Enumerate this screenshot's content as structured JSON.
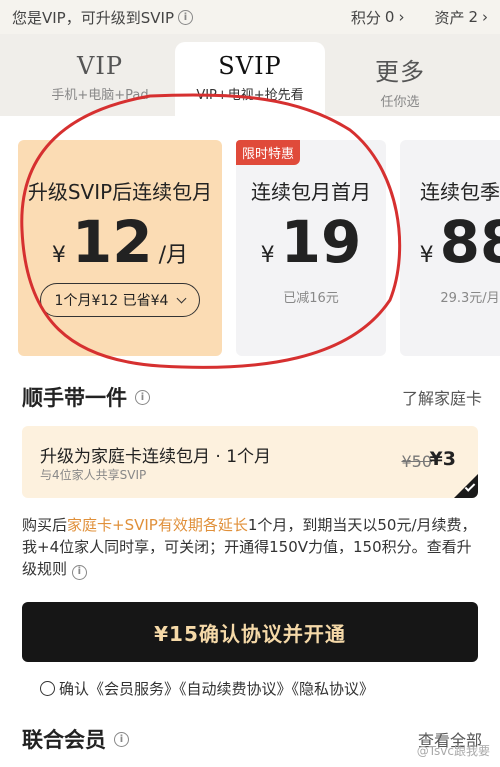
{
  "topbar": {
    "status": "您是VIP，可升级到SVIP",
    "points_label": "积分",
    "points_value": "0",
    "assets_label": "资产",
    "assets_value": "2"
  },
  "tabs": [
    {
      "name": "VIP",
      "sub": "手机+电脑+Pad"
    },
    {
      "name": "SVIP",
      "sub": "VIP+电视+抢先看"
    },
    {
      "name": "更多",
      "sub": "任你选"
    }
  ],
  "plans": [
    {
      "title": "升级SVIP后连续包月",
      "currency": "¥",
      "amount": "12",
      "unit": "/月",
      "selector": "1个月¥12 已省¥4"
    },
    {
      "badge": "限时特惠",
      "title": "连续包月首月",
      "currency": "¥",
      "amount": "19",
      "note": "已减16元"
    },
    {
      "title": "连续包季首",
      "currency": "¥",
      "amount": "88",
      "note": "29.3元/月"
    }
  ],
  "addon": {
    "heading": "顺手带一件",
    "link": "了解家庭卡",
    "card_title": "升级为家庭卡连续包月 · 1个月",
    "card_sub": "与4位家人共享SVIP",
    "old_price": "¥50",
    "new_price": "¥3"
  },
  "description": {
    "prefix": "购买后",
    "highlight": "家庭卡+SVIP有效期各延长",
    "suffix": "1个月，到期当天以50元/月续费，我+4位家人同时享，可关闭；开通得150V力值，150积分。查看升级规则"
  },
  "cta_label": "¥15确认协议并开通",
  "agreement": "确认《会员服务》《自动续费协议》《隐私协议》",
  "joint": {
    "heading": "联合会员",
    "link": "查看全部"
  },
  "watermark": "@Tsvc跟我要",
  "colors": {
    "accent_gold": "#fbdcb4",
    "badge_red": "#e04a3a",
    "cta_bg": "#161616",
    "highlight": "#e0903a"
  }
}
